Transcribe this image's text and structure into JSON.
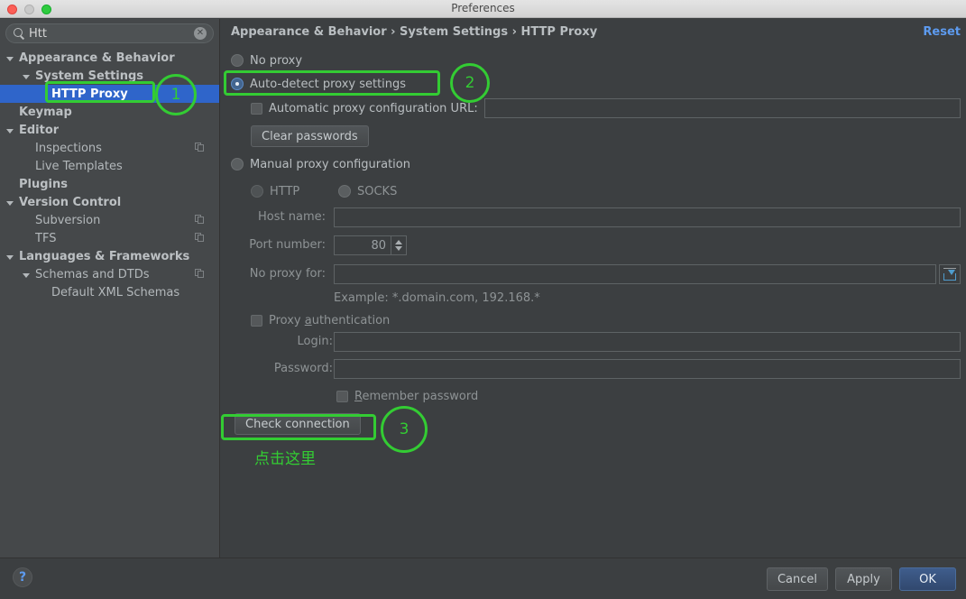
{
  "window": {
    "title": "Preferences",
    "traffic_lights": [
      "close-red",
      "minimize-gray",
      "zoom-green"
    ]
  },
  "sidebar": {
    "search": {
      "value": "Htt",
      "icon": "search-icon",
      "clear_icon": "clear-circle-icon"
    },
    "tree": [
      {
        "label": "Appearance & Behavior",
        "indent": 0,
        "arrow": true,
        "bold": true,
        "selected": false,
        "copy": false
      },
      {
        "label": "System Settings",
        "indent": 1,
        "arrow": true,
        "bold": true,
        "selected": false,
        "copy": false
      },
      {
        "label": "HTTP Proxy",
        "indent": 2,
        "arrow": false,
        "bold": true,
        "selected": true,
        "copy": false
      },
      {
        "label": "Keymap",
        "indent": 0,
        "arrow": false,
        "bold": true,
        "selected": false,
        "copy": false
      },
      {
        "label": "Editor",
        "indent": 0,
        "arrow": true,
        "bold": true,
        "selected": false,
        "copy": false
      },
      {
        "label": "Inspections",
        "indent": 1,
        "arrow": false,
        "bold": false,
        "selected": false,
        "copy": true
      },
      {
        "label": "Live Templates",
        "indent": 1,
        "arrow": false,
        "bold": false,
        "selected": false,
        "copy": false
      },
      {
        "label": "Plugins",
        "indent": 0,
        "arrow": false,
        "bold": true,
        "selected": false,
        "copy": false
      },
      {
        "label": "Version Control",
        "indent": 0,
        "arrow": true,
        "bold": true,
        "selected": false,
        "copy": false
      },
      {
        "label": "Subversion",
        "indent": 1,
        "arrow": false,
        "bold": false,
        "selected": false,
        "copy": true
      },
      {
        "label": "TFS",
        "indent": 1,
        "arrow": false,
        "bold": false,
        "selected": false,
        "copy": true
      },
      {
        "label": "Languages & Frameworks",
        "indent": 0,
        "arrow": true,
        "bold": true,
        "selected": false,
        "copy": false
      },
      {
        "label": "Schemas and DTDs",
        "indent": 1,
        "arrow": true,
        "bold": false,
        "selected": false,
        "copy": true
      },
      {
        "label": "Default XML Schemas",
        "indent": 2,
        "arrow": false,
        "bold": false,
        "selected": false,
        "copy": false
      }
    ]
  },
  "main": {
    "breadcrumb": "Appearance & Behavior › System Settings › HTTP Proxy",
    "reset_label": "Reset",
    "proxy_mode": {
      "no_proxy": "No proxy",
      "auto_detect": "Auto-detect proxy settings",
      "manual": "Manual proxy configuration",
      "selected": "auto_detect"
    },
    "auto_pac_label": "Automatic proxy configuration URL:",
    "auto_pac_value": "",
    "clear_passwords_label": "Clear passwords",
    "protocol": {
      "http": "HTTP",
      "socks": "SOCKS",
      "selected": "http"
    },
    "host_name_label": "Host name:",
    "host_name_value": "",
    "port_number_label": "Port number:",
    "port_number_value": "80",
    "no_proxy_for_label": "No proxy for:",
    "no_proxy_for_value": "",
    "no_proxy_for_icon": "insert-expand-icon",
    "example_text": "Example: *.domain.com, 192.168.*",
    "proxy_auth_label_pre": "Proxy ",
    "proxy_auth_label_underline": "a",
    "proxy_auth_label_post": "uthentication",
    "login_label": "Login:",
    "login_value": "",
    "password_label": "Password:",
    "password_value": "",
    "remember_password_underline": "R",
    "remember_password_post": "emember password",
    "check_connection_label": "Check connection"
  },
  "annotations": {
    "color": "#33cc33",
    "badge_1": "1",
    "badge_2": "2",
    "badge_3": "3",
    "note": "点击这里"
  },
  "bottom": {
    "help_icon": "question-mark-icon",
    "cancel_label": "Cancel",
    "apply_label": "Apply",
    "ok_label": "OK"
  }
}
